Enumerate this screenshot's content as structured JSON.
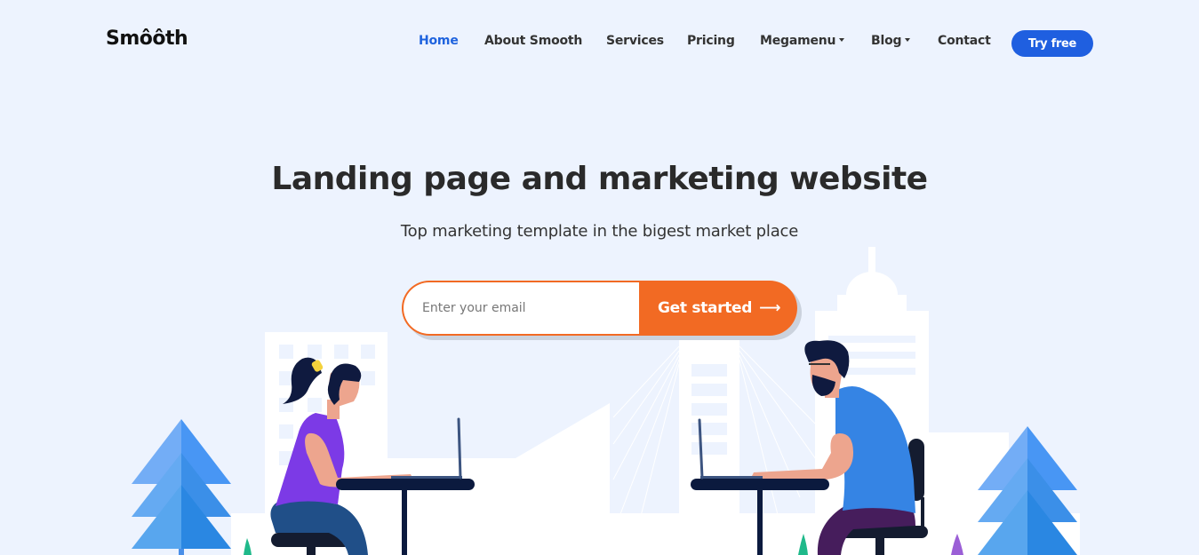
{
  "brand": {
    "logo_text": "Smôôth"
  },
  "nav": {
    "items": [
      {
        "label": "Home",
        "active": true,
        "dropdown": false
      },
      {
        "label": "About Smooth",
        "active": false,
        "dropdown": false
      },
      {
        "label": "Services",
        "active": false,
        "dropdown": false
      },
      {
        "label": "Pricing",
        "active": false,
        "dropdown": false
      },
      {
        "label": "Megamenu",
        "active": false,
        "dropdown": true
      },
      {
        "label": "Blog",
        "active": false,
        "dropdown": true
      },
      {
        "label": "Contact",
        "active": false,
        "dropdown": false
      }
    ],
    "cta_label": "Try free"
  },
  "hero": {
    "title": "Landing page and marketing website",
    "subtitle": "Top marketing template in the bigest market place",
    "email_placeholder": "Enter your email",
    "email_value": "",
    "submit_label": "Get started",
    "submit_icon": "arrow-right-icon"
  },
  "colors": {
    "background": "#edf3fe",
    "accent_blue": "#1f5fe0",
    "accent_orange": "#f26a23",
    "text_dark": "#2a2a2a"
  },
  "illustration": {
    "description": "Two people working on laptops at desks in front of a city skyline with trees"
  }
}
